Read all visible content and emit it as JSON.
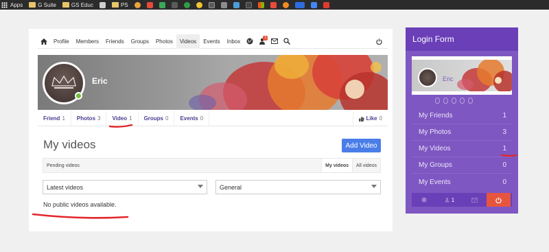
{
  "bookmarks": {
    "apps": "Apps",
    "items": [
      "G Suite",
      "GS Educ",
      "",
      "PS"
    ]
  },
  "nav": {
    "items": [
      "Profile",
      "Members",
      "Friends",
      "Groups",
      "Photos",
      "Videos",
      "Events",
      "Inbox"
    ],
    "active": "Videos",
    "notification_count": "1"
  },
  "profile": {
    "name": "Eric"
  },
  "profile_tabs": [
    {
      "label": "Friend",
      "count": "1"
    },
    {
      "label": "Photos",
      "count": "3"
    },
    {
      "label": "Video",
      "count": "1"
    },
    {
      "label": "Groups",
      "count": "0"
    },
    {
      "label": "Events",
      "count": "0"
    }
  ],
  "like": {
    "label": "Like",
    "count": "0"
  },
  "videos": {
    "title": "My videos",
    "add_button": "Add Video",
    "pending": "Pending videos",
    "tab_my": "My videos",
    "tab_all": "All videos",
    "sort_select": "Latest videos",
    "category_select": "General",
    "empty_message": "No public videos available."
  },
  "login_panel": {
    "title": "Login Form",
    "name": "Eric",
    "stats": [
      {
        "label": "My Friends",
        "value": "1"
      },
      {
        "label": "My Photos",
        "value": "3"
      },
      {
        "label": "My Videos",
        "value": "1"
      },
      {
        "label": "My Groups",
        "value": "0"
      },
      {
        "label": "My Events",
        "value": "0"
      }
    ],
    "footer_count": "1"
  },
  "colors": {
    "accent": "#7e57c2",
    "accent_dark": "#6a3fb8",
    "button_blue": "#4a7de8",
    "logout_red": "#e8553e",
    "annotation_red": "#e3262b"
  }
}
